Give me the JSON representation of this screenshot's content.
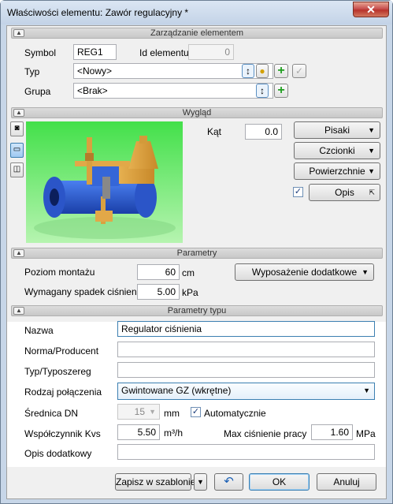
{
  "window": {
    "title": "Właściwości elementu: Zawór regulacyjny *",
    "close": "✕"
  },
  "sections": {
    "mgmt": "Zarządzanie elementem",
    "look": "Wygląd",
    "params": "Parametry",
    "typeparams": "Parametry typu"
  },
  "mgmt": {
    "symbol_label": "Symbol",
    "symbol_value": "REG1",
    "id_label": "Id elementu",
    "id_value": "0",
    "type_label": "Typ",
    "type_value": "<Nowy>",
    "group_label": "Grupa",
    "group_value": "<Brak>"
  },
  "look": {
    "angle_label": "Kąt",
    "angle_value": "0.0",
    "angle_unit": "°",
    "pens": "Pisaki",
    "fonts": "Czcionki",
    "surfaces": "Powierzchnie",
    "desc": "Opis",
    "desc_checked": "✓"
  },
  "params": {
    "mount_label": "Poziom montażu",
    "mount_value": "60",
    "mount_unit": "cm",
    "drop_label": "Wymagany spadek ciśnienia",
    "drop_value": "5.00",
    "drop_unit": "kPa",
    "extra": "Wyposażenie dodatkowe"
  },
  "typeparams": {
    "name_label": "Nazwa",
    "name_value": "Regulator ciśnienia",
    "norm_label": "Norma/Producent",
    "norm_value": "",
    "series_label": "Typ/Typoszereg",
    "series_value": "",
    "conn_label": "Rodzaj połączenia",
    "conn_value": "Gwintowane GZ (wkrętne)",
    "dn_label": "Średnica DN",
    "dn_value": "15",
    "dn_unit": "mm",
    "auto_label": "Automatycznie",
    "auto_checked": "✓",
    "kvs_label": "Współczynnik Kvs",
    "kvs_value": "5.50",
    "kvs_unit": "m³/h",
    "pmax_label": "Max ciśnienie pracy",
    "pmax_value": "1.60",
    "pmax_unit": "MPa",
    "extra_label": "Opis dodatkowy",
    "extra_value": ""
  },
  "footer": {
    "save_template": "Zapisz w szablonie",
    "ok": "OK",
    "cancel": "Anuluj"
  },
  "colors": {
    "green": "#1f9e1f",
    "title_bg": "#c7d6e8"
  }
}
